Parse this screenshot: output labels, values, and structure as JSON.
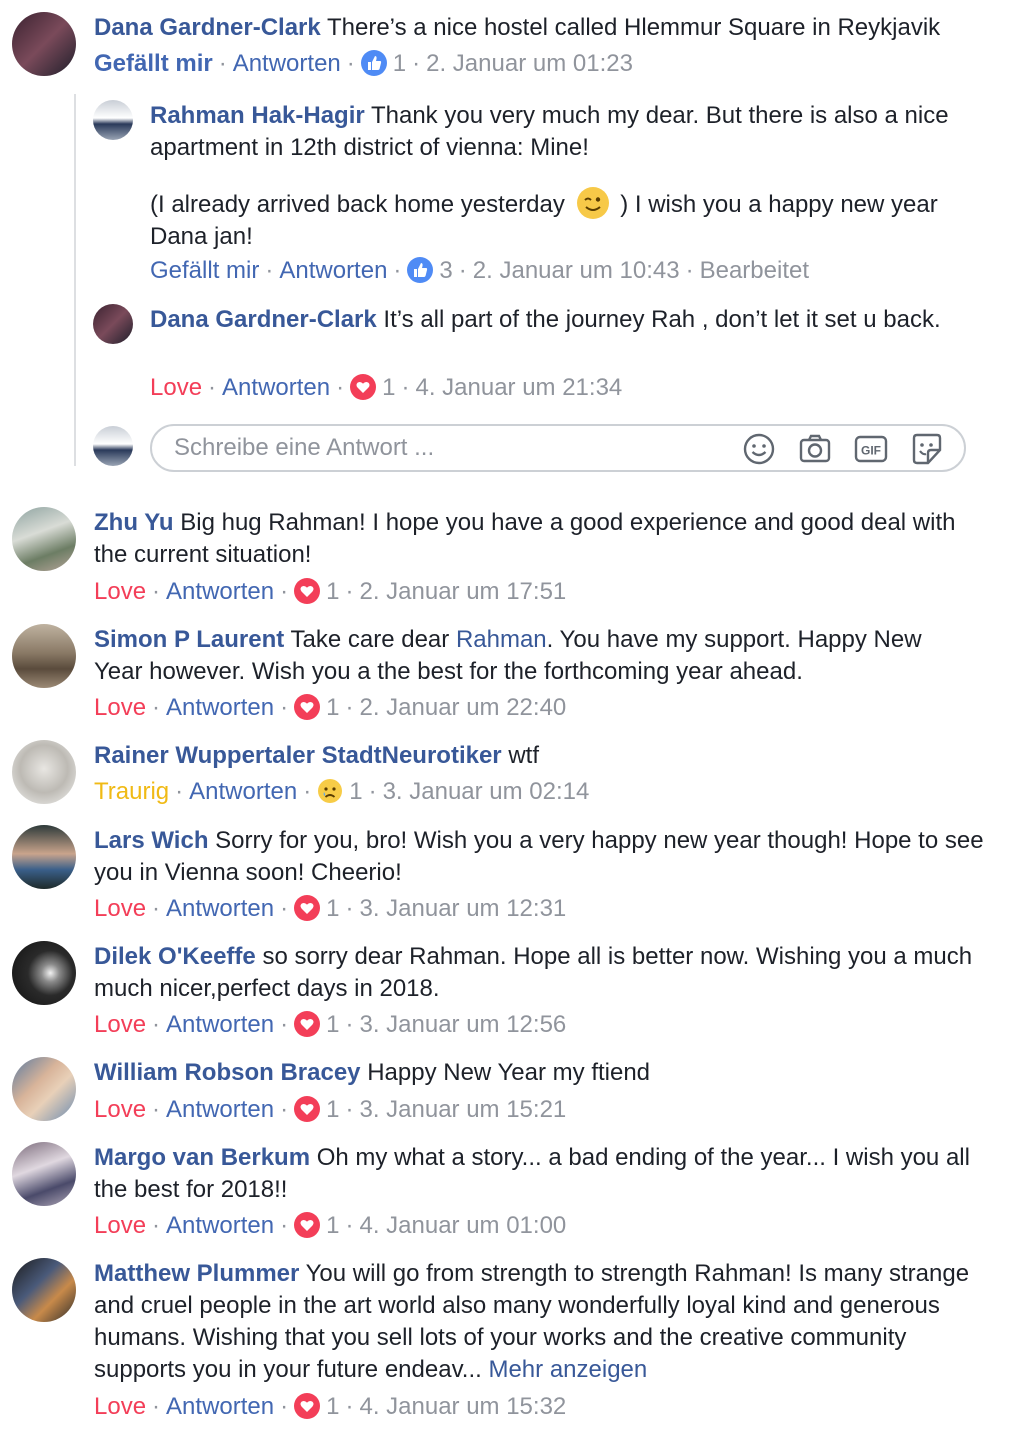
{
  "colors": {
    "link": "#385898",
    "action": "#4267b2",
    "meta": "#90949c",
    "love": "#f33e58",
    "sad": "#f0ba15"
  },
  "thread": {
    "parent": {
      "name": "Dana Gardner-Clark",
      "text": "There’s a nice hostel called Hlemmur Square in Reykjavik",
      "action1": "Gefällt mir",
      "reply": "Antworten",
      "count": "1",
      "time": "2. Januar um 01:23"
    },
    "replies": [
      {
        "name": "Rahman Hak-Hagir",
        "text": "Thank you very much my dear. But there is also a nice apartment in 12th district of vienna: Mine!",
        "text2a": "(I already arrived back home yesterday",
        "text2b": ") I wish you a happy new year Dana jan!",
        "action1": "Gefällt mir",
        "reply": "Antworten",
        "count": "3",
        "time": "2. Januar um 10:43",
        "edited": "Bearbeitet"
      },
      {
        "name": "Dana Gardner-Clark",
        "text": "It’s all part of the journey Rah , don’t let it set u back.",
        "action1": "Love",
        "reply": "Antworten",
        "count": "1",
        "time": "4. Januar um 21:34"
      }
    ],
    "reply_placeholder": "Schreibe eine Antwort ...",
    "reply_icons": [
      "smiley-icon",
      "camera-icon",
      "gif-icon",
      "sticker-icon"
    ],
    "gif_label": "GIF"
  },
  "comments": [
    {
      "name": "Zhu Yu",
      "text": "Big hug Rahman! I hope you have a good experience and good deal with the current situation!",
      "action1": "Love",
      "reply": "Antworten",
      "count": "1",
      "time": "2. Januar um 17:51"
    },
    {
      "name": "Simon P Laurent",
      "text_pre": "Take care dear",
      "mention": "Rahman",
      "text_post": ". You have my support. Happy New Year however. Wish you a the best for the forthcoming year ahead.",
      "action1": "Love",
      "reply": "Antworten",
      "count": "1",
      "time": "2. Januar um 22:40"
    },
    {
      "name": "Rainer Wuppertaler StadtNeurotiker",
      "text": "wtf",
      "action1": "Traurig",
      "reply": "Antworten",
      "count": "1",
      "time": "3. Januar um 02:14"
    },
    {
      "name": "Lars Wich",
      "text": "Sorry for you, bro! Wish you a very happy new year though! Hope to see you in Vienna soon! Cheerio!",
      "action1": "Love",
      "reply": "Antworten",
      "count": "1",
      "time": "3. Januar um 12:31"
    },
    {
      "name": "Dilek O'Keeffe",
      "text": "so sorry dear Rahman. Hope all is better now. Wishing you a much much nicer,perfect days in 2018.",
      "action1": "Love",
      "reply": "Antworten",
      "count": "1",
      "time": "3. Januar um 12:56"
    },
    {
      "name": "William Robson Bracey",
      "text": "Happy New Year my ftiend",
      "action1": "Love",
      "reply": "Antworten",
      "count": "1",
      "time": "3. Januar um 15:21"
    },
    {
      "name": "Margo van Berkum",
      "text": "Oh my what a story... a bad ending of the year... I wish you all the best for 2018!!",
      "action1": "Love",
      "reply": "Antworten",
      "count": "1",
      "time": "4. Januar um 01:00"
    },
    {
      "name": "Matthew Plummer",
      "text": "You will go from strength to strength Rahman! Is many strange and cruel people in the art world also many wonderfully loyal kind and generous humans. Wishing that you sell lots of your works and the creative community supports you in your future endeav...",
      "more": "Mehr anzeigen",
      "action1": "Love",
      "reply": "Antworten",
      "count": "1",
      "time": "4. Januar um 15:32"
    }
  ]
}
